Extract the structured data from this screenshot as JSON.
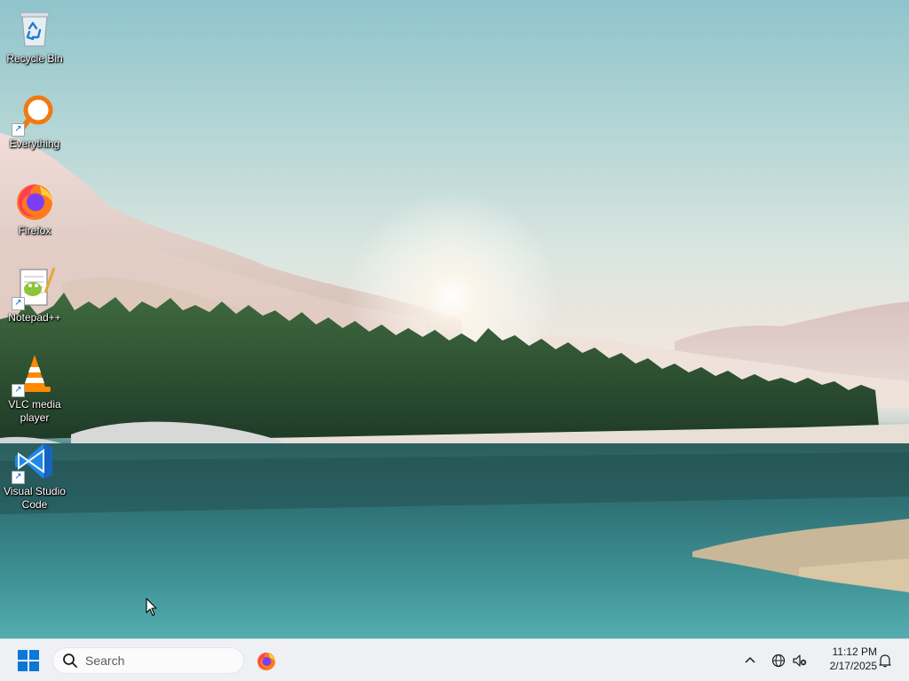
{
  "desktop": {
    "icons": [
      {
        "label": "Recycle Bin",
        "icon": "recycle-bin-icon"
      },
      {
        "label": "Everything",
        "icon": "everything-search-icon"
      },
      {
        "label": "Firefox",
        "icon": "firefox-icon"
      },
      {
        "label": "Notepad++",
        "icon": "notepad-plus-plus-icon"
      },
      {
        "label": "VLC media player",
        "icon": "vlc-cone-icon"
      },
      {
        "label": "Visual Studio Code",
        "icon": "vscode-icon"
      }
    ]
  },
  "taskbar": {
    "start_icon": "windows-logo-icon",
    "search": {
      "placeholder": "Search",
      "value": ""
    },
    "pinned": [
      {
        "icon": "firefox-icon"
      }
    ],
    "tray": {
      "icons": [
        "chevron-up-icon",
        "network-globe-icon",
        "volume-muted-icon",
        "bell-icon"
      ],
      "time": "11:12 PM",
      "date": "2/17/2025"
    }
  },
  "colors": {
    "taskbar_bg": "#eef0f3",
    "start_blue": "#0a78d4"
  }
}
